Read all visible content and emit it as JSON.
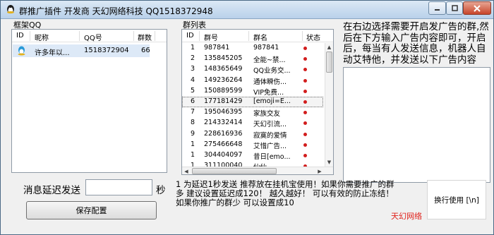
{
  "window": {
    "title": "群推广插件   开发商 天幻网络科技   QQ1518372948"
  },
  "qq_panel": {
    "label": "框架QQ",
    "columns": [
      "ID",
      "昵称",
      "QQ号",
      "群数"
    ],
    "rows": [
      {
        "nickname": "许多年以...",
        "qq": "1518372904",
        "groups": "66"
      }
    ]
  },
  "group_panel": {
    "label": "群列表",
    "columns": [
      "ID",
      "群号",
      "群名",
      "状态"
    ],
    "rows": [
      {
        "id": "1",
        "group_no": "987841",
        "name": "987841"
      },
      {
        "id": "2",
        "group_no": "135845205",
        "name": "全能~禁..."
      },
      {
        "id": "3",
        "group_no": "148365649",
        "name": "QQ业务交..."
      },
      {
        "id": "4",
        "group_no": "149236264",
        "name": "通体瞬伤..."
      },
      {
        "id": "5",
        "group_no": "150889599",
        "name": "VIP免费..."
      },
      {
        "id": "6",
        "group_no": "177181429",
        "name": "[emoji=E..."
      },
      {
        "id": "7",
        "group_no": "195046395",
        "name": "家族交友"
      },
      {
        "id": "8",
        "group_no": "214332414",
        "name": "天幻引流..."
      },
      {
        "id": "9",
        "group_no": "228616936",
        "name": "寂寞的爱情"
      },
      {
        "id": "1",
        "group_no": "275466648",
        "name": "艾惜广告..."
      },
      {
        "id": "1",
        "group_no": "304404097",
        "name": "昔日[emo..."
      },
      {
        "id": "1",
        "group_no": "311100040",
        "name": "仙仙 ..."
      }
    ],
    "selected_index": 5
  },
  "instructions": "在右边选择需要开启发广告的群,然后在下方输入广告内容即可，开启后，每当有人发送信息，机器人自动艾特他，并发送以下广告内容",
  "ad_content": "",
  "delay": {
    "label": "消息延迟发送",
    "value": "",
    "unit": "秒"
  },
  "save_button": "保存配置",
  "tip": "1 为延迟1秒发送      推荐放在挂机宝使用！如果你需要推广的群多 建议设置延迟成120！ 越久越好！ 可以有效的防止冻结！ 如果你推广的群少 可以设置成10",
  "brand": "天幻网络",
  "newline_hint": "换行使用 [\\n]",
  "colors": {
    "status_dot": "#d21d1d",
    "brand": "#e0201a"
  }
}
